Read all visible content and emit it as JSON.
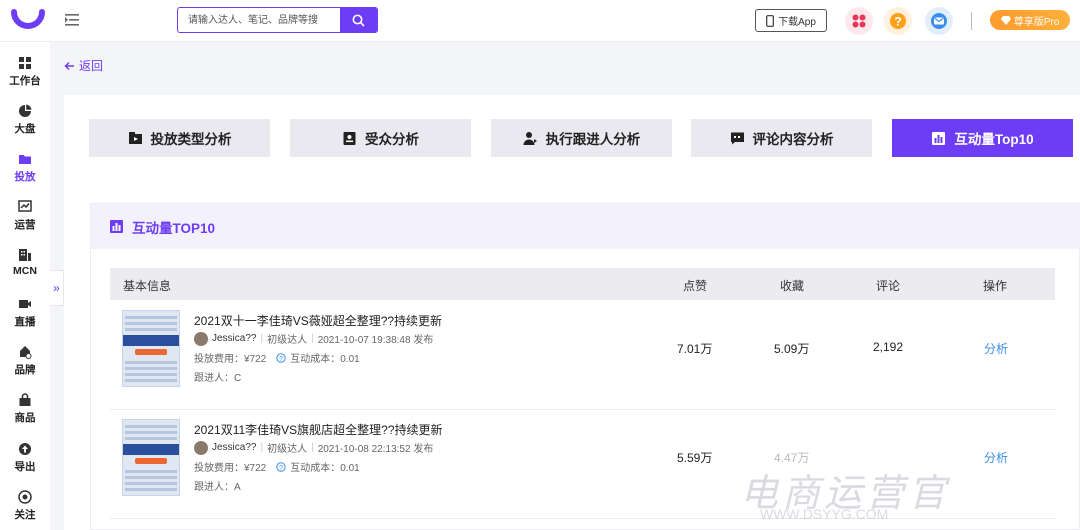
{
  "header": {
    "search_placeholder": "请输入达人、笔记、品牌等搜",
    "download_label": "下载App",
    "pro_label": "尊享版Pro"
  },
  "sidebar": {
    "items": [
      {
        "label": "工作台",
        "icon": "grid-icon"
      },
      {
        "label": "大盘",
        "icon": "pie-icon"
      },
      {
        "label": "投放",
        "icon": "folder-icon",
        "active": true
      },
      {
        "label": "运营",
        "icon": "chart-icon"
      },
      {
        "label": "MCN",
        "icon": "building-icon"
      },
      {
        "label": "直播",
        "icon": "video-icon"
      },
      {
        "label": "品牌",
        "icon": "brand-icon"
      },
      {
        "label": "商品",
        "icon": "bag-icon"
      },
      {
        "label": "导出",
        "icon": "export-icon"
      },
      {
        "label": "关注",
        "icon": "eye-icon"
      }
    ],
    "expand_glyph": "»"
  },
  "back_label": "返回",
  "tabs": [
    {
      "label": "投放类型分析",
      "icon": "media-icon"
    },
    {
      "label": "受众分析",
      "icon": "id-card-icon"
    },
    {
      "label": "执行跟进人分析",
      "icon": "person-icon"
    },
    {
      "label": "评论内容分析",
      "icon": "comment-icon"
    },
    {
      "label": "互动量Top10",
      "icon": "bar-chart-icon",
      "active": true
    }
  ],
  "panel": {
    "title": "互动量TOP10",
    "columns": [
      "基本信息",
      "点赞",
      "收藏",
      "评论",
      "操作"
    ],
    "rows": [
      {
        "title": "2021双十一李佳琦VS薇娅超全整理??持续更新",
        "author": "Jessica??",
        "level": "初级达人",
        "published": "2021-10-07 19:38:48 发布",
        "cost_label": "投放费用：¥722",
        "interaction_cost_label": "互动成本：0.01",
        "follower_label": "跟进人：C",
        "likes": "7.01万",
        "favorites": "5.09万",
        "comments": "2,192",
        "action": "分析"
      },
      {
        "title": "2021双11李佳琦VS旗舰店超全整理??持续更新",
        "author": "Jessica??",
        "level": "初级达人",
        "published": "2021-10-08 22:13:52 发布",
        "cost_label": "投放费用：¥722",
        "interaction_cost_label": "互动成本：0.01",
        "follower_label": "跟进人：A",
        "likes": "5.59万",
        "favorites": "4.47万",
        "comments": "",
        "action": "分析"
      }
    ]
  },
  "watermark": {
    "main": "电商运营官",
    "sub": "WWW.DSYYG.COM"
  },
  "colors": {
    "accent": "#6d3cf5",
    "link": "#3b8ee8",
    "pro": "#ff9a2e"
  }
}
